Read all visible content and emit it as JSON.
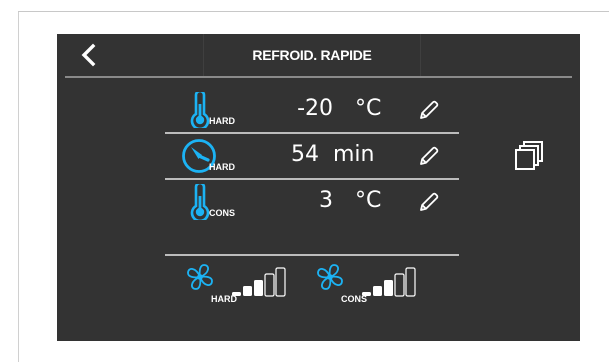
{
  "header": {
    "title": "REFROID. RAPIDE",
    "back_icon": "chevron-left-icon"
  },
  "rows": [
    {
      "icon": "thermometer-icon",
      "sub_label": "HARD",
      "value": "-20",
      "unit": "°C",
      "edit_icon": "pencil-icon"
    },
    {
      "icon": "timer-dial-icon",
      "sub_label": "HARD",
      "value": "54",
      "unit": "min",
      "edit_icon": "pencil-icon"
    },
    {
      "icon": "thermometer-icon",
      "sub_label": "CONS",
      "value": "3",
      "unit": "°C",
      "edit_icon": "pencil-icon"
    }
  ],
  "fans": [
    {
      "icon": "fan-icon",
      "sub_label": "HARD",
      "level": 3,
      "max_level": 5
    },
    {
      "icon": "fan-icon",
      "sub_label": "CONS",
      "level": 3,
      "max_level": 5
    }
  ],
  "side_actions": {
    "copy_icon": "copy-layers-icon"
  },
  "colors": {
    "screen_bg": "#333333",
    "accent": "#1cb3f4",
    "text": "#ffffff",
    "rule": "#bcbcbc"
  }
}
